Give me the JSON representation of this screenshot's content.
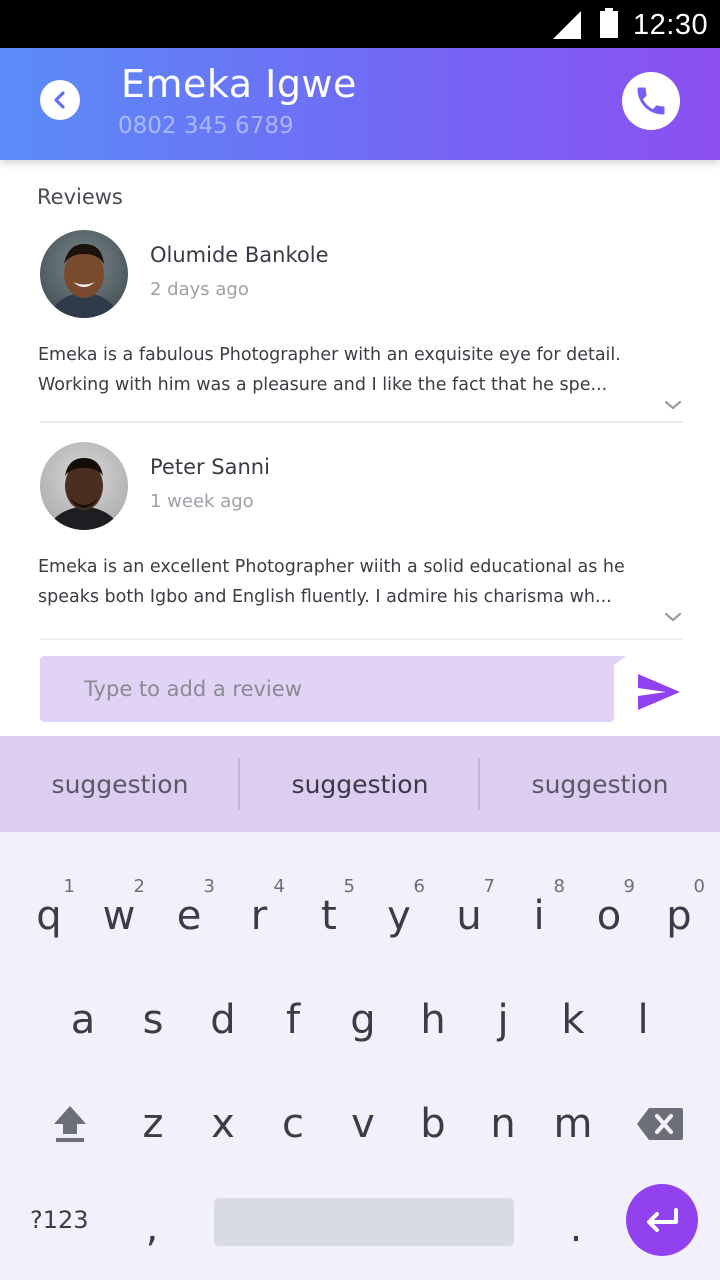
{
  "status_bar": {
    "time": "12:30"
  },
  "header": {
    "contact_name": "Emeka Igwe",
    "contact_phone": "0802 345 6789"
  },
  "reviews_heading": "Reviews",
  "reviews": [
    {
      "name": "Olumide Bankole",
      "time": "2 days ago",
      "text_line1": "Emeka is a fabulous Photographer with an exquisite eye for detail.",
      "text_line2": "Working with him was a pleasure and I like the fact that he spe..."
    },
    {
      "name": "Peter Sanni",
      "time": "1 week ago",
      "text_line1": "Emeka is an excellent Photographer wiith a solid educational as he",
      "text_line2": "speaks both Igbo and English fluently. I admire his charisma wh..."
    }
  ],
  "review_input": {
    "placeholder": "Type to add a review",
    "value": ""
  },
  "keyboard": {
    "suggestions": [
      "suggestion",
      "suggestion",
      "suggestion"
    ],
    "row1": [
      "q",
      "w",
      "e",
      "r",
      "t",
      "y",
      "u",
      "i",
      "o",
      "p"
    ],
    "row1_hints": [
      "1",
      "2",
      "3",
      "4",
      "5",
      "6",
      "7",
      "8",
      "9",
      "0"
    ],
    "row2": [
      "a",
      "s",
      "d",
      "f",
      "g",
      "h",
      "j",
      "k",
      "l"
    ],
    "row3": [
      "z",
      "x",
      "c",
      "v",
      "b",
      "n",
      "m"
    ],
    "symbols_label": "?123",
    "comma": ",",
    "period": "."
  },
  "colors": {
    "header_gradient_start": "#5b8cf7",
    "header_gradient_end": "#8c4ff1",
    "accent_purple": "#9141ee",
    "input_background": "#e1d3f5",
    "suggestion_bar": "#ddcdf1"
  },
  "icons": {
    "back": "chevron-left-icon",
    "call": "phone-icon",
    "send": "send-icon",
    "expand": "chevron-down-icon",
    "shift": "shift-icon",
    "backspace": "backspace-icon",
    "enter": "enter-icon"
  }
}
